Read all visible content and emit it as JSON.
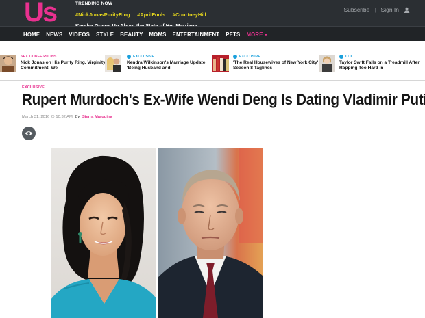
{
  "header": {
    "logo_text": "Us",
    "trending_title": "TRENDING NOW",
    "tags": [
      "#NickJonasPurityRing",
      "#AprilFools",
      "#CourtneyHill"
    ],
    "trending_headline": "Kendra Opens Up About the State of Her Marriage",
    "subscribe": "Subscribe",
    "separator": "|",
    "sign_in": "Sign In"
  },
  "nav": {
    "items": [
      "HOME",
      "NEWS",
      "VIDEOS",
      "STYLE",
      "BEAUTY",
      "MOMS",
      "ENTERTAINMENT",
      "PETS"
    ],
    "more": "MORE ▾"
  },
  "related": [
    {
      "category": "SEX CONFESSIONS",
      "title": "Nick Jonas on His Purity Ring, Virginity Commitment: We"
    },
    {
      "category": "EXCLUSIVE",
      "title": "Kendra Wilkinson's Marriage Update: 'Being Husband and"
    },
    {
      "category": "EXCLUSIVE",
      "title": "'The Real Housewives of New York City' Season 8 Taglines"
    },
    {
      "category": "LOL",
      "title": "Taylor Swift Falls on a Treadmill After Rapping Too Hard in"
    }
  ],
  "article": {
    "badge": "EXCLUSIVE",
    "headline": "Rupert Murdoch's Ex-Wife Wendi Deng Is Dating Vladimir Putin",
    "date": "March 31, 2016 @ 10:32 AM",
    "by": "By",
    "author": "Sierra Marquina"
  },
  "colors": {
    "accent_pink": "#e8318f",
    "trending_yellow": "#e3d41e",
    "topbar": "#2b2f33",
    "nav": "#212427",
    "category_blue": "#1aa0dc"
  }
}
